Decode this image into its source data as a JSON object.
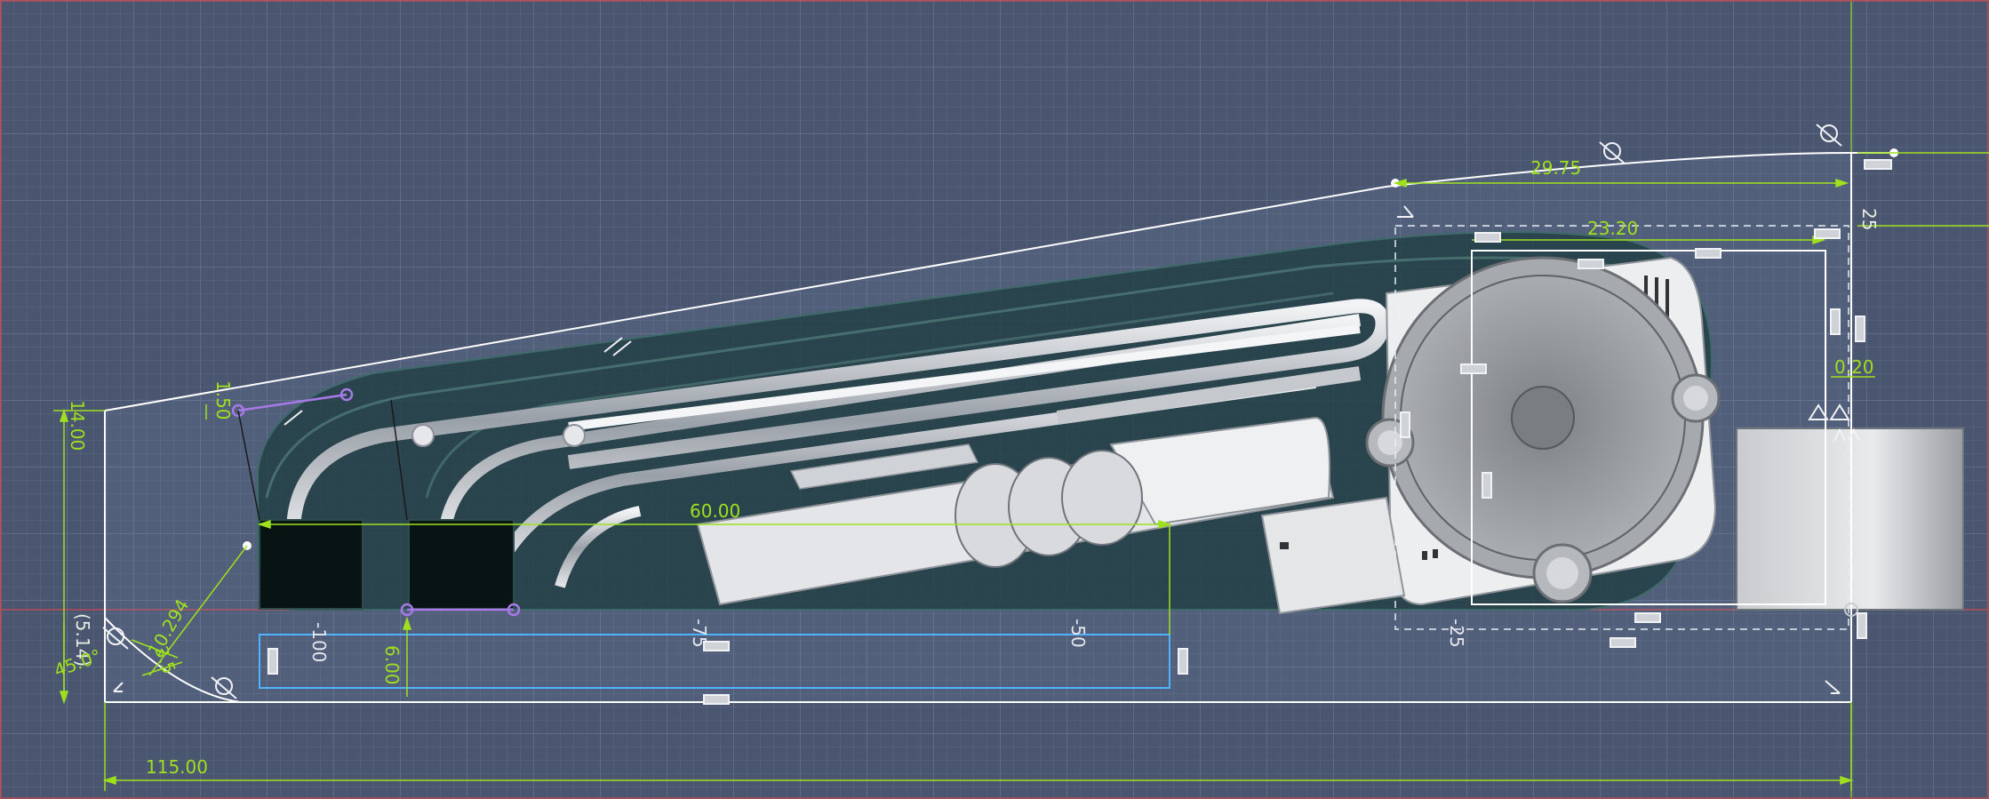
{
  "colors": {
    "background": "#4a5570",
    "grid_minor": "#5a6784",
    "grid_major": "#6b7893",
    "sketch_line": "#ffffff",
    "dimension": "#9fe01e",
    "axis_red": "#b94a4a",
    "axis_green": "#8bc34a",
    "constraint_purple": "#a779e6",
    "selection_blue": "#4fb3ff",
    "body_dark": "#1f3a3c",
    "part_light": "#d6d8db"
  },
  "dimensions": {
    "d_29_75": "29.75",
    "d_23_20": "23.20",
    "d_25": "25",
    "d_0_20": "0.20",
    "d_14_00": "14.00",
    "d_1_50": "1.50",
    "d_60_00": "60.00",
    "d_6_00": "6.00",
    "d_10_294": "10.294",
    "d_5_14": "(5.14)",
    "d_45": "45.0°",
    "d_3_5": "3.5",
    "d_115_00": "115.00"
  },
  "ruler_ticks": [
    "-100",
    "-75",
    "-50",
    "-25"
  ],
  "icons": {
    "horizontal_constraint": "horizontal-constraint-icon",
    "vertical_constraint": "vertical-constraint-icon",
    "tangent_constraint": "tangent-constraint-icon",
    "coincident_constraint": "coincident-constraint-icon",
    "parallel_constraint": "parallel-constraint-icon",
    "perpendicular_constraint": "perpendicular-constraint-icon"
  }
}
